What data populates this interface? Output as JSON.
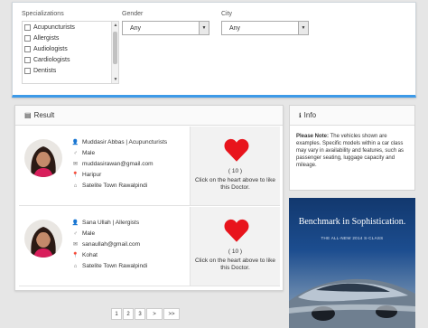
{
  "filters": {
    "specializations": {
      "label": "Specializations",
      "options": [
        "Acupuncturists",
        "Allergists",
        "Audiologists",
        "Cardiologists",
        "Dentists"
      ]
    },
    "gender": {
      "label": "Gender",
      "value": "Any"
    },
    "city": {
      "label": "City",
      "value": "Any"
    }
  },
  "result": {
    "heading": "Result",
    "doctors": [
      {
        "name_line": "Muddasir Abbas | Acupuncturists",
        "gender": "Male",
        "email": "muddasirawan@gmail.com",
        "city": "Haripur",
        "address": "Satelite Town Rawalpindi",
        "likes": "( 10 )",
        "like_text": "Click on the heart above to like this Doctor."
      },
      {
        "name_line": "Sana Ullah | Allergists",
        "gender": "Male",
        "email": "sanaullah@gmail.com",
        "city": "Kohat",
        "address": "Satelite Town Rawalpindi",
        "likes": "( 10 )",
        "like_text": "Click on the heart above to like this Doctor."
      }
    ]
  },
  "pagination": [
    "1",
    "2",
    "3",
    ">",
    ">>"
  ],
  "info": {
    "heading": "Info",
    "note_label": "Please Note:",
    "note_text": " The vehicles shown are examples. Specific models within a car class may vary in availability and features, such as passenger seating, luggage capacity and mileage."
  },
  "ad": {
    "title": "Benchmark in Sophistication.",
    "subtitle": "THE ALL-NEW 2014 S-CLASS"
  },
  "colors": {
    "accent": "#3d9ae8",
    "heart": "#e8141c"
  }
}
